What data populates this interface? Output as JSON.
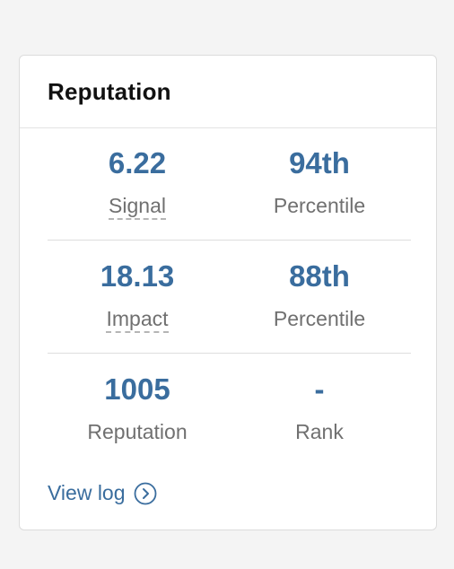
{
  "card": {
    "title": "Reputation"
  },
  "stats": {
    "signal": {
      "value": "6.22",
      "label": "Signal"
    },
    "signal_percentile": {
      "value": "94th",
      "label": "Percentile"
    },
    "impact": {
      "value": "18.13",
      "label": "Impact"
    },
    "impact_percentile": {
      "value": "88th",
      "label": "Percentile"
    },
    "reputation": {
      "value": "1005",
      "label": "Reputation"
    },
    "rank": {
      "value": "-",
      "label": "Rank"
    }
  },
  "footer": {
    "view_log_label": "View log",
    "view_log_icon": "chevron-right-circle-icon"
  },
  "colors": {
    "accent": "#3a6d9e",
    "label": "#707070",
    "background": "#f4f4f4",
    "card": "#ffffff"
  }
}
